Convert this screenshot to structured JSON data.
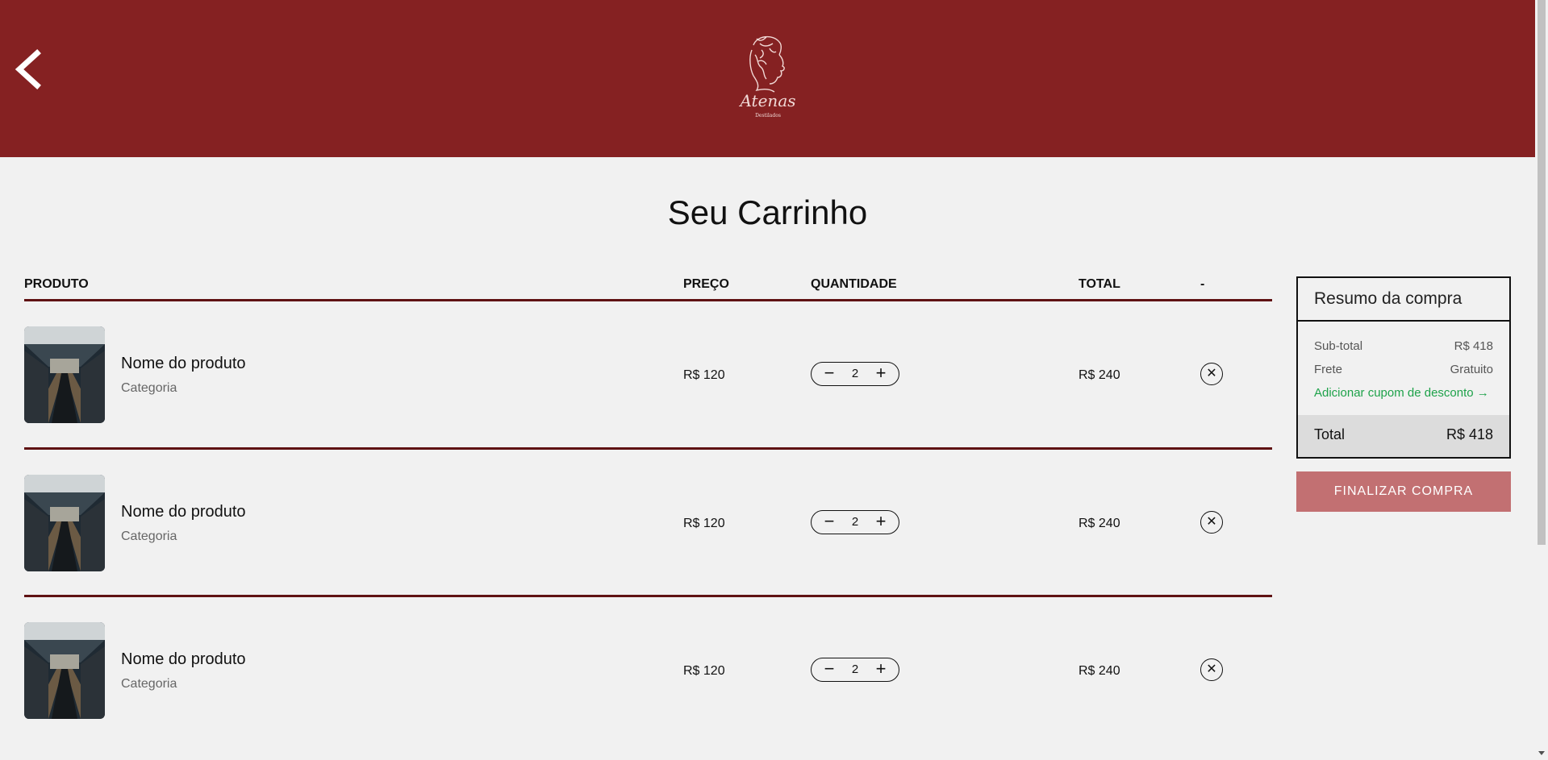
{
  "header": {
    "logo_text": "Atenas",
    "logo_subtext": "Destilados",
    "colors": {
      "header_bg": "#852122",
      "logo_color": "#f1d9d6"
    },
    "icons": {
      "back": "chevron-left-icon"
    }
  },
  "page_title": "Seu Carrinho",
  "table": {
    "headers": {
      "product": "PRODUTO",
      "price": "PREÇO",
      "quantity": "QUANTIDADE",
      "total": "TOTAL",
      "remove": "-"
    },
    "rows": [
      {
        "name": "Nome do produto",
        "category": "Categoria",
        "price": "R$ 120",
        "quantity": "2",
        "total": "R$ 240"
      },
      {
        "name": "Nome do produto",
        "category": "Categoria",
        "price": "R$ 120",
        "quantity": "2",
        "total": "R$ 240"
      },
      {
        "name": "Nome do produto",
        "category": "Categoria",
        "price": "R$ 120",
        "quantity": "2",
        "total": "R$ 240"
      }
    ],
    "stepper": {
      "minus": "−",
      "plus": "+"
    },
    "remove_symbol": "✕",
    "divider_color": "#5f1213"
  },
  "summary": {
    "title": "Resumo da compra",
    "subtotal_label": "Sub-total",
    "subtotal_value": "R$ 418",
    "shipping_label": "Frete",
    "shipping_value": "Gratuito",
    "coupon_link": "Adicionar cupom de desconto →",
    "total_label": "Total",
    "total_value": "R$ 418",
    "coupon_color": "#1ea24a"
  },
  "checkout_button": "FINALIZAR COMPRA",
  "checkout_color": "#c27072"
}
